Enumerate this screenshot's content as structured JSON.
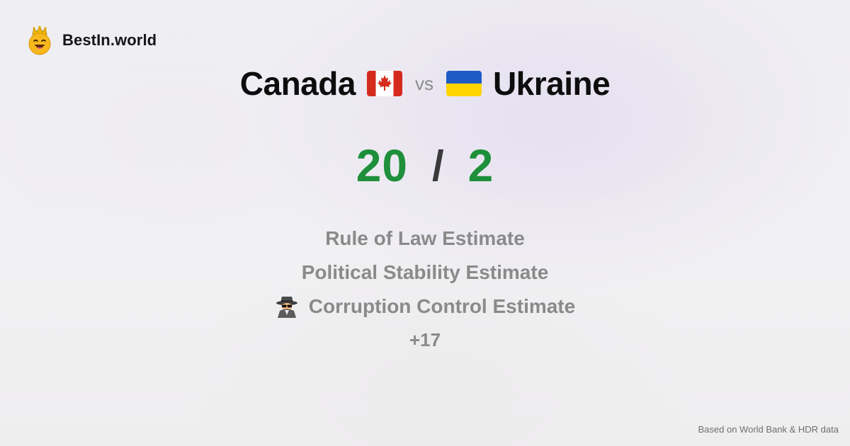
{
  "brand": {
    "name": "BestIn.world",
    "logo_icon": "crowned-smiley-icon"
  },
  "comparison": {
    "left": {
      "name": "Canada",
      "flag_icon": "canada-flag-icon"
    },
    "vs_label": "vs",
    "right": {
      "name": "Ukraine",
      "flag_icon": "ukraine-flag-icon"
    }
  },
  "score": {
    "left": "20",
    "separator": "/",
    "right": "2",
    "color": "#1e8f3a"
  },
  "metrics": [
    {
      "label": "Rule of Law Estimate"
    },
    {
      "label": "Political Stability Estimate"
    },
    {
      "label": "Corruption Control Estimate",
      "icon": "detective-icon"
    }
  ],
  "more_label": "+17",
  "footer": {
    "source_note": "Based on World Bank & HDR data"
  }
}
